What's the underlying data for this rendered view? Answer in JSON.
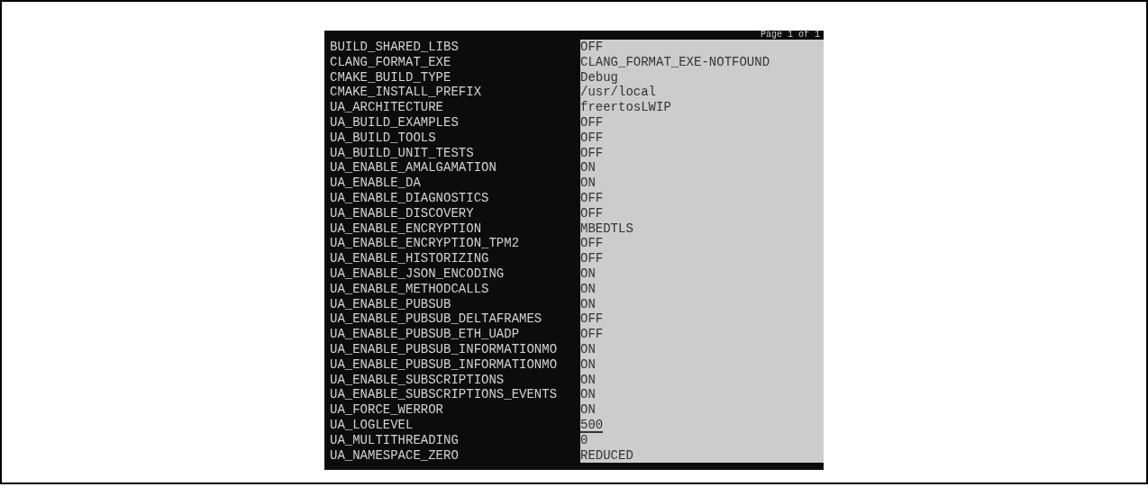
{
  "header": {
    "page_indicator": "Page 1 of 1"
  },
  "entries": [
    {
      "name": "BUILD_SHARED_LIBS",
      "value": "OFF",
      "selected": false
    },
    {
      "name": "CLANG_FORMAT_EXE",
      "value": "CLANG_FORMAT_EXE-NOTFOUND",
      "selected": false
    },
    {
      "name": "CMAKE_BUILD_TYPE",
      "value": "Debug",
      "selected": false
    },
    {
      "name": "CMAKE_INSTALL_PREFIX",
      "value": "/usr/local",
      "selected": false
    },
    {
      "name": "UA_ARCHITECTURE",
      "value": "freertosLWIP",
      "selected": false
    },
    {
      "name": "UA_BUILD_EXAMPLES",
      "value": "OFF",
      "selected": false
    },
    {
      "name": "UA_BUILD_TOOLS",
      "value": "OFF",
      "selected": false
    },
    {
      "name": "UA_BUILD_UNIT_TESTS",
      "value": "OFF",
      "selected": false
    },
    {
      "name": "UA_ENABLE_AMALGAMATION",
      "value": "ON",
      "selected": false
    },
    {
      "name": "UA_ENABLE_DA",
      "value": "ON",
      "selected": false
    },
    {
      "name": "UA_ENABLE_DIAGNOSTICS",
      "value": "OFF",
      "selected": false
    },
    {
      "name": "UA_ENABLE_DISCOVERY",
      "value": "OFF",
      "selected": false
    },
    {
      "name": "UA_ENABLE_ENCRYPTION",
      "value": "MBEDTLS",
      "selected": false
    },
    {
      "name": "UA_ENABLE_ENCRYPTION_TPM2",
      "value": "OFF",
      "selected": false
    },
    {
      "name": "UA_ENABLE_HISTORIZING",
      "value": "OFF",
      "selected": false
    },
    {
      "name": "UA_ENABLE_JSON_ENCODING",
      "value": "ON",
      "selected": false
    },
    {
      "name": "UA_ENABLE_METHODCALLS",
      "value": "ON",
      "selected": false
    },
    {
      "name": "UA_ENABLE_PUBSUB",
      "value": "ON",
      "selected": false
    },
    {
      "name": "UA_ENABLE_PUBSUB_DELTAFRAMES",
      "value": "OFF",
      "selected": false
    },
    {
      "name": "UA_ENABLE_PUBSUB_ETH_UADP",
      "value": "OFF",
      "selected": false
    },
    {
      "name": "UA_ENABLE_PUBSUB_INFORMATIONMO",
      "value": "ON",
      "selected": false
    },
    {
      "name": "UA_ENABLE_PUBSUB_INFORMATIONMO",
      "value": "ON",
      "selected": false
    },
    {
      "name": "UA_ENABLE_SUBSCRIPTIONS",
      "value": "ON",
      "selected": false
    },
    {
      "name": "UA_ENABLE_SUBSCRIPTIONS_EVENTS",
      "value": "ON",
      "selected": false
    },
    {
      "name": "UA_FORCE_WERROR",
      "value": "ON",
      "selected": false
    },
    {
      "name": "UA_LOGLEVEL",
      "value": "500",
      "selected": true
    },
    {
      "name": "UA_MULTITHREADING",
      "value": "0",
      "selected": false
    },
    {
      "name": "UA_NAMESPACE_ZERO",
      "value": "REDUCED",
      "selected": false
    }
  ]
}
